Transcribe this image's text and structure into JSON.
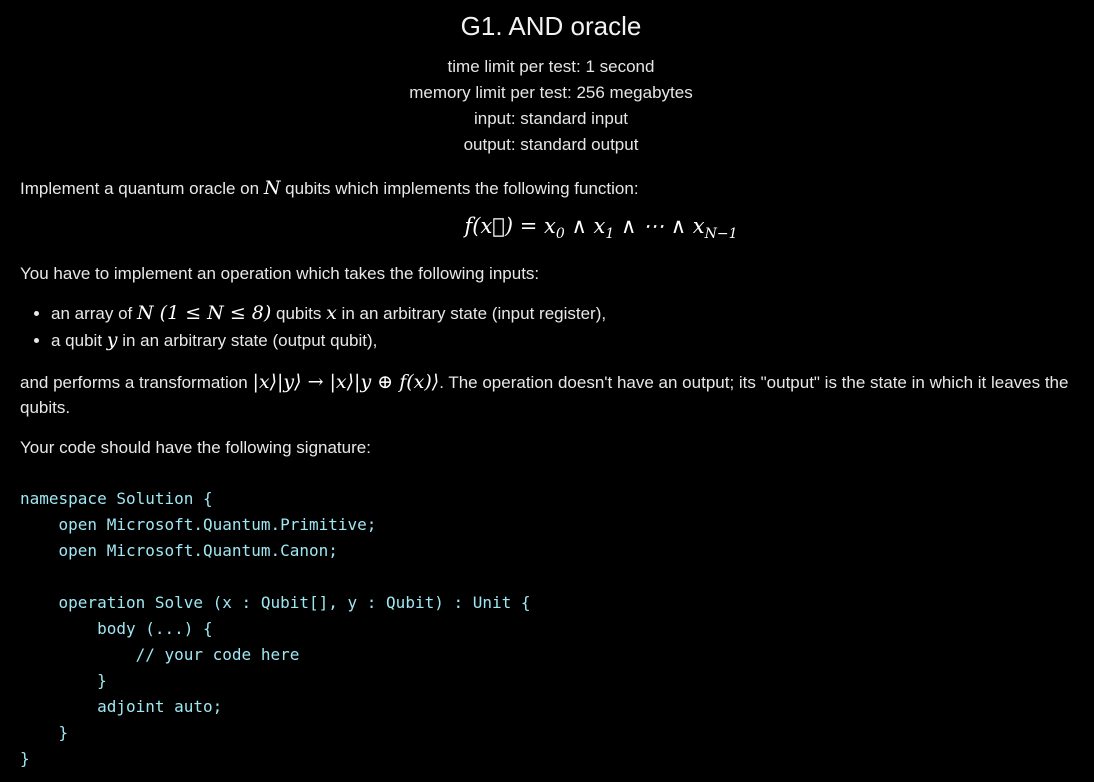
{
  "problem": {
    "title": "G1. AND oracle",
    "time_limit": "time limit per test: 1 second",
    "memory_limit": "memory limit per test: 256 megabytes",
    "input": "input: standard input",
    "output": "output: standard output"
  },
  "statement": {
    "intro_before": "Implement a quantum oracle on ",
    "intro_var": "N",
    "intro_after": " qubits which implements the following function:",
    "formula": "f(x⃗) = x₀ ∧ x₁ ∧ ⋯ ∧ x_{N−1}",
    "formula_lhs": "f(x⃗) = x",
    "formula_sub0": "0",
    "formula_mid1": " ∧ x",
    "formula_sub1": "1",
    "formula_mid2": " ∧ ⋯ ∧ x",
    "formula_sub2": "N−1",
    "inputs_intro": "You have to implement an operation which takes the following inputs:",
    "bullet1_a": "an array of ",
    "bullet1_math": "N (1 ≤ N ≤ 8)",
    "bullet1_b": " qubits ",
    "bullet1_var": "x",
    "bullet1_c": " in an arbitrary state (input register),",
    "bullet2_a": "a qubit ",
    "bullet2_var": "y",
    "bullet2_b": " in an arbitrary state (output qubit),",
    "transform_a": "and performs a transformation ",
    "transform_math": "|x⟩|y⟩ → |x⟩|y ⊕ f(x)⟩",
    "transform_b": ". The operation doesn't have an output; its \"output\" is the state in which it leaves the qubits.",
    "signature_intro": "Your code should have the following signature:"
  },
  "code": "namespace Solution {\n    open Microsoft.Quantum.Primitive;\n    open Microsoft.Quantum.Canon;\n\n    operation Solve (x : Qubit[], y : Qubit) : Unit {\n        body (...) {\n            // your code here\n        }\n        adjoint auto;\n    }\n}"
}
